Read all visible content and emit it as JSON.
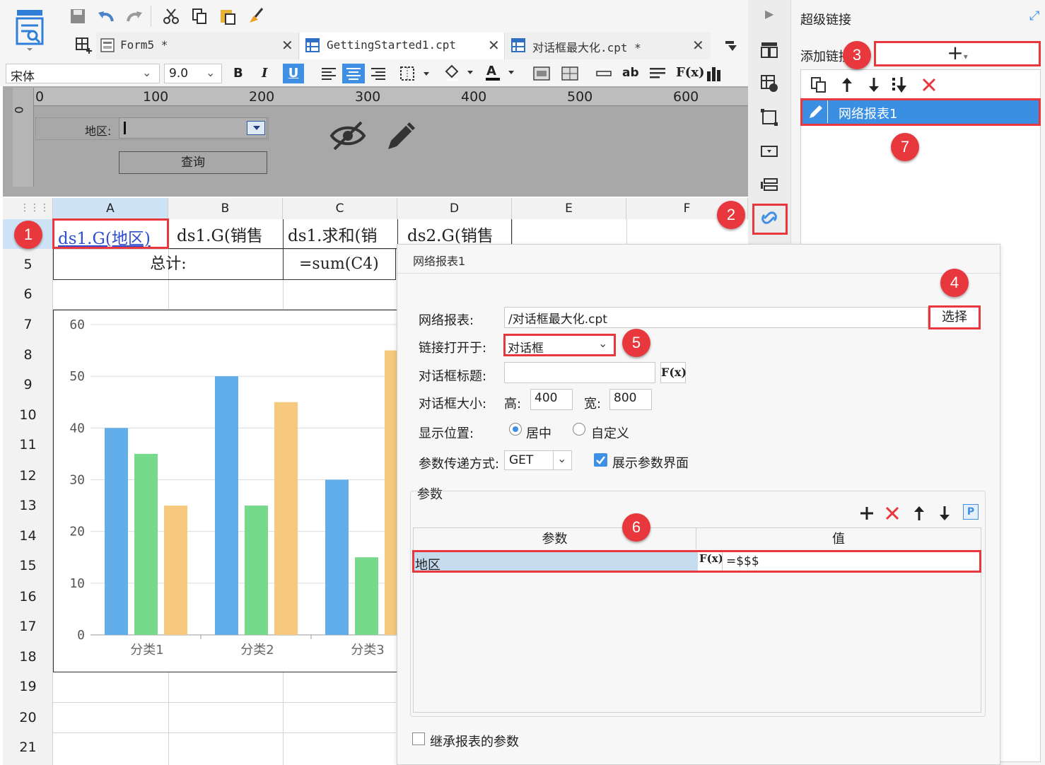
{
  "toolbar": {
    "font_name": "宋体",
    "font_size": "9.0",
    "bold": "B",
    "italic": "I",
    "underline": "U",
    "ab_label": "ab",
    "fx_label": "F(x)"
  },
  "tabs": [
    {
      "label": "Form5 *"
    },
    {
      "label": "GettingStarted1.cpt"
    },
    {
      "label": "对话框最大化.cpt *"
    }
  ],
  "ruler": {
    "ticks": [
      "0",
      "100",
      "200",
      "300",
      "400",
      "500",
      "600"
    ],
    "left_zero": "0"
  },
  "param_panel": {
    "region_label": "地区:",
    "query_button": "查询"
  },
  "sheet": {
    "columns": [
      "A",
      "B",
      "C",
      "D",
      "E",
      "F"
    ],
    "rows": [
      "5",
      "6",
      "7",
      "8",
      "9",
      "10",
      "11",
      "12",
      "13",
      "14",
      "15",
      "16",
      "17",
      "18",
      "19",
      "20",
      "21"
    ],
    "cell_a4": "ds1.G(地区)",
    "cell_b4": "ds1.G(销售",
    "cell_c4": "ds1.求和(销",
    "cell_d4": "ds2.G(销售",
    "cell_total": "总计:",
    "cell_sum": "=sum(C4)"
  },
  "chart_data": {
    "type": "bar",
    "categories": [
      "分类1",
      "分类2",
      "分类3"
    ],
    "series": [
      {
        "values": [
          40,
          50,
          30
        ],
        "color": "#62aeeb"
      },
      {
        "values": [
          35,
          25,
          15
        ],
        "color": "#77d98c"
      },
      {
        "values": [
          25,
          45,
          55
        ],
        "color": "#f7c97f"
      }
    ],
    "ylim": [
      0,
      60
    ],
    "yticks": [
      "0",
      "10",
      "20",
      "30",
      "40",
      "50",
      "60"
    ],
    "grid": true
  },
  "hyperlink_panel": {
    "title": "超级链接",
    "add_label": "添加链接",
    "add_button": "+",
    "item": "网络报表1"
  },
  "dialog": {
    "header": "网络报表1",
    "report_label": "网络报表:",
    "report_value": "/对话框最大化.cpt",
    "select_button": "选择",
    "open_in_label": "链接打开于:",
    "open_in_value": "对话框",
    "dialog_title_label": "对话框标题:",
    "dialog_title_value": "",
    "dialog_size_label": "对话框大小:",
    "height_label": "高:",
    "height_value": "400",
    "width_label": "宽:",
    "width_value": "800",
    "position_label": "显示位置:",
    "position_center": "居中",
    "position_custom": "自定义",
    "method_label": "参数传递方式:",
    "method_value": "GET",
    "show_params_label": "展示参数界面",
    "params_section": "参数",
    "table_header_param": "参数",
    "table_header_value": "值",
    "param_name": "地区",
    "param_value": "=$$$",
    "inherit_label": "继承报表的参数"
  },
  "badges": [
    "1",
    "2",
    "3",
    "4",
    "5",
    "6",
    "7"
  ],
  "colors": {
    "accent_blue": "#3f8fe5",
    "annotation_red": "#e8383d",
    "selected_item": "#3a8fe3"
  }
}
